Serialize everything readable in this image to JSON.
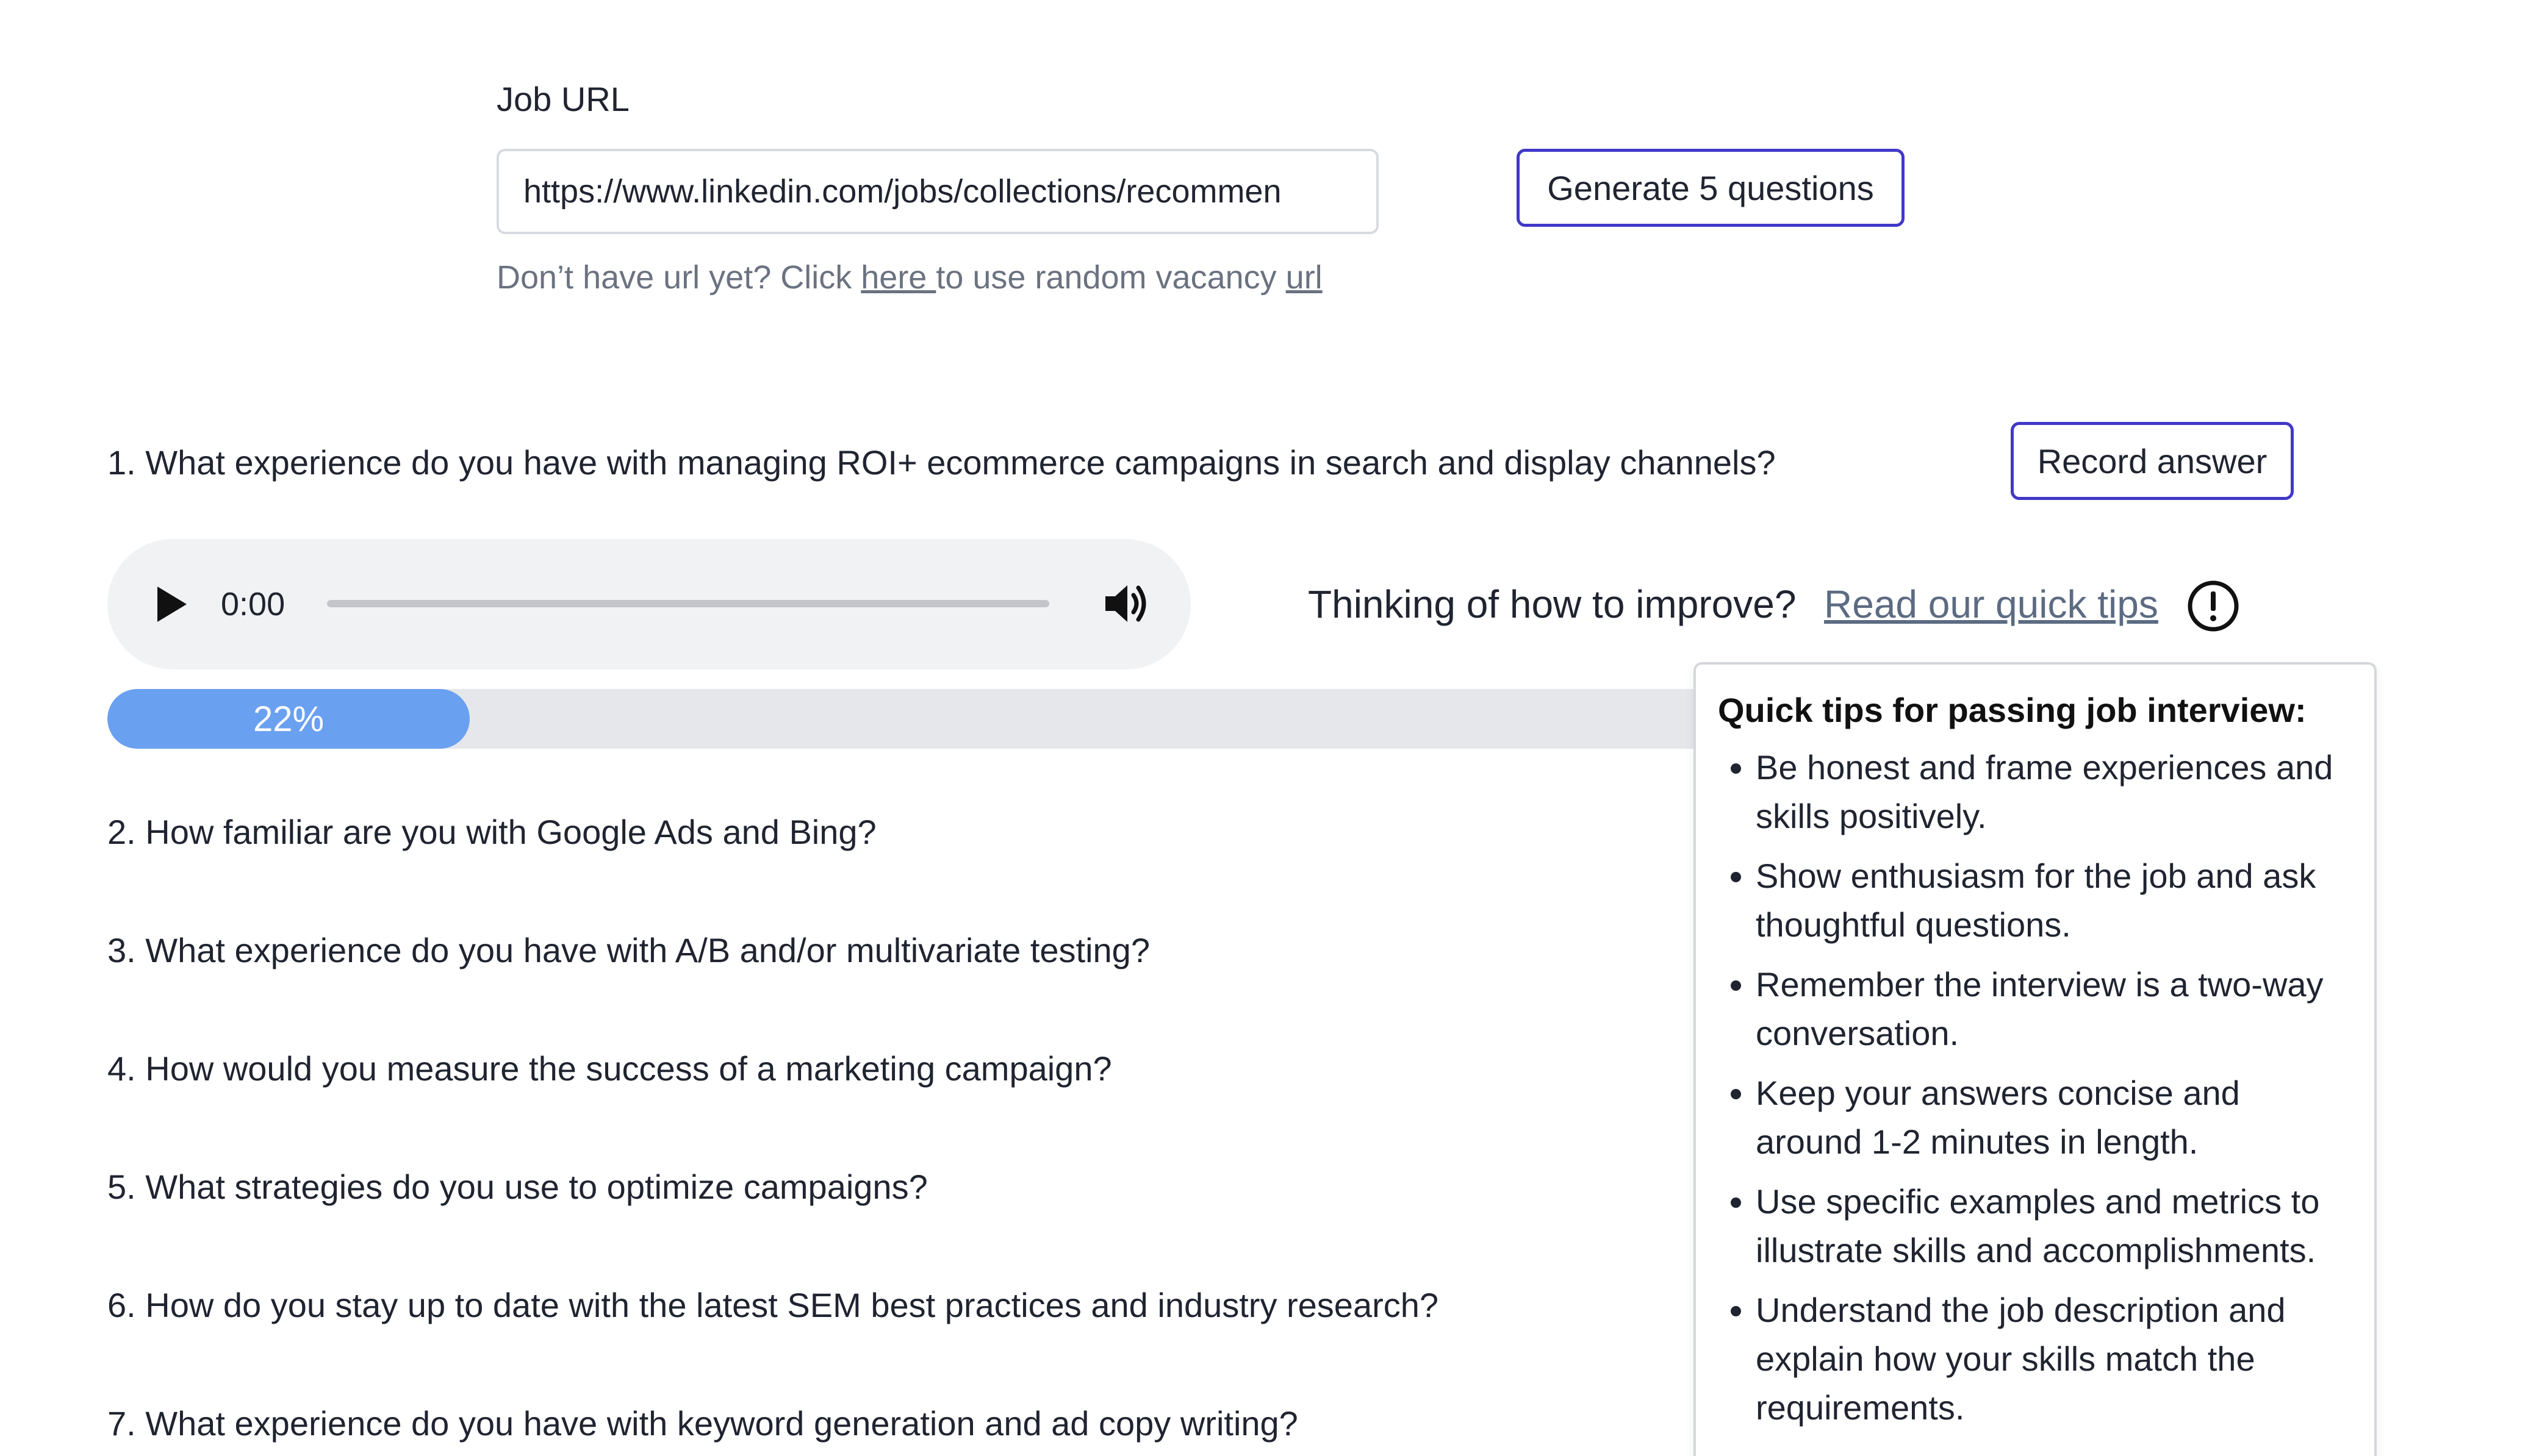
{
  "job": {
    "label": "Job URL",
    "url_value": "https://www.linkedin.com/jobs/collections/recommen",
    "generate_button": "Generate 5 questions",
    "hint_prefix": "Don’t have url yet? Click ",
    "hint_link": "here ",
    "hint_middle": "to use random vacancy ",
    "hint_url_link": "url"
  },
  "questions": [
    "1. What experience do you have with managing ROI+ ecommerce campaigns in search and display channels?",
    "2. How familiar are you with Google Ads and Bing?",
    "3. What experience do you have with A/B and/or multivariate testing?",
    "4. How would you measure the success of a marketing campaign?",
    "5. What strategies do you use to optimize campaigns?",
    "6. How do you stay up to date with the latest SEM best practices and industry research?",
    "7. What experience do you have with keyword generation and ad copy writing?"
  ],
  "record_button": "Record answer",
  "audio": {
    "time": "0:00",
    "progress": 0
  },
  "improve": {
    "text": "Thinking of how to improve?",
    "link": "Read our quick tips"
  },
  "progress": {
    "percent": 22,
    "label": "22%"
  },
  "tips": {
    "title": "Quick tips for passing job interview:",
    "items": [
      "Be honest and frame experiences and skills positively.",
      "Show enthusiasm for the job and ask thoughtful questions.",
      "Remember the interview is a two-way conversation.",
      "Keep your answers concise and around 1-2 minutes in length.",
      "Use specific examples and metrics to illustrate skills and accomplishments.",
      "Understand the job description and explain how your skills match the requirements."
    ]
  },
  "colors": {
    "accent_border": "#4138c9",
    "progress_fill": "#6aa0f0",
    "link_gray": "#5c6b82"
  },
  "icons": [
    "play-icon",
    "volume-icon",
    "info-icon"
  ]
}
